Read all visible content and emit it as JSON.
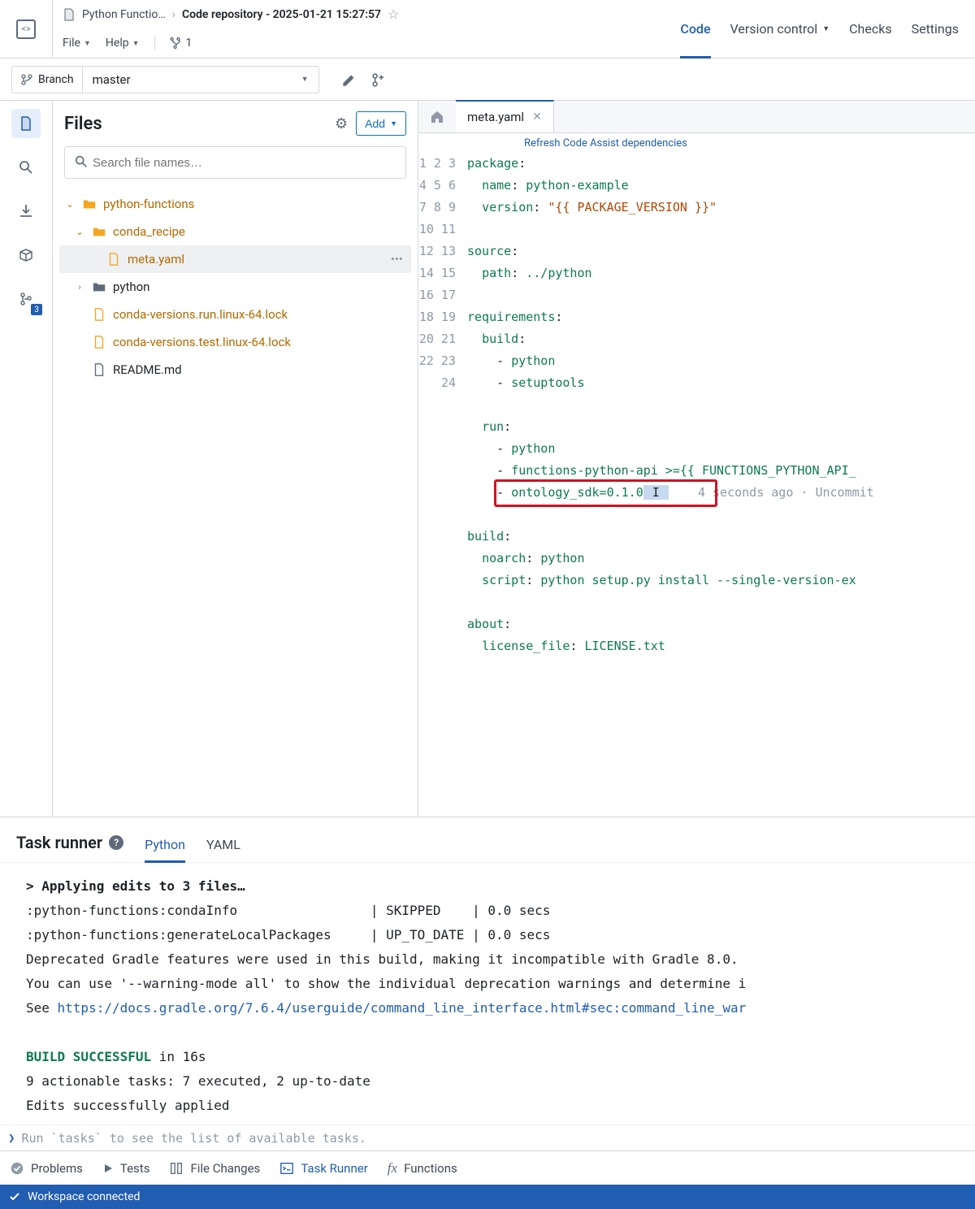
{
  "breadcrumb": {
    "project": "Python Functio…",
    "current": "Code repository - 2025-01-21 15:27:57"
  },
  "menu": {
    "file": "File",
    "help": "Help",
    "fork_count": "1"
  },
  "top_tabs": {
    "code": "Code",
    "version": "Version control",
    "checks": "Checks",
    "settings": "Settings"
  },
  "branch": {
    "label": "Branch",
    "value": "master"
  },
  "rail": {
    "badge": "3"
  },
  "files": {
    "title": "Files",
    "add": "Add",
    "search_placeholder": "Search file names…"
  },
  "tree": {
    "root": "python-functions",
    "conda": "conda_recipe",
    "meta": "meta.yaml",
    "python": "python",
    "lock1": "conda-versions.run.linux-64.lock",
    "lock2": "conda-versions.test.linux-64.lock",
    "readme": "README.md"
  },
  "editor": {
    "tab": "meta.yaml",
    "refresh": "Refresh Code Assist dependencies",
    "blame": "4 seconds ago · Uncommit"
  },
  "code": {
    "l1a": "package",
    "l1b": ":",
    "l2a": "name",
    "l2b": ": ",
    "l2c": "python-example",
    "l3a": "version",
    "l3b": ": ",
    "l3c": "\"{{ PACKAGE_VERSION }}\"",
    "l5a": "source",
    "l5b": ":",
    "l6a": "path",
    "l6b": ": ",
    "l6c": "../python",
    "l8a": "requirements",
    "l8b": ":",
    "l9a": "build",
    "l9b": ":",
    "l10a": "- ",
    "l10b": "python",
    "l11a": "- ",
    "l11b": "setuptools",
    "l13a": "run",
    "l13b": ":",
    "l14a": "- ",
    "l14b": "python",
    "l15a": "- ",
    "l15b": "functions-python-api >={{ FUNCTIONS_PYTHON_API_",
    "l16a": "- ",
    "l16b": "ontology_sdk=0.1.0",
    "l18a": "build",
    "l18b": ":",
    "l19a": "noarch",
    "l19b": ": ",
    "l19c": "python",
    "l20a": "script",
    "l20b": ": ",
    "l20c": "python setup.py install --single-version-ex",
    "l22a": "about",
    "l22b": ":",
    "l23a": "license_file",
    "l23b": ": ",
    "l23c": "LICENSE.txt"
  },
  "task": {
    "title": "Task runner",
    "tab_python": "Python",
    "tab_yaml": "YAML"
  },
  "console": {
    "l1": "> Applying edits to 3 files…",
    "l2": ":python-functions:condaInfo                 | SKIPPED    | 0.0 secs",
    "l3": ":python-functions:generateLocalPackages     | UP_TO_DATE | 0.0 secs",
    "l4": "Deprecated Gradle features were used in this build, making it incompatible with Gradle 8.0.",
    "l5": "You can use '--warning-mode all' to show the individual deprecation warnings and determine i",
    "l6a": "See ",
    "l6b": "https://docs.gradle.org/7.6.4/userguide/command_line_interface.html#sec:command_line_war",
    "l8a": "BUILD SUCCESSFUL",
    "l8b": " in 16s",
    "l9": "9 actionable tasks: 7 executed, 2 up-to-date",
    "l10": "Edits successfully applied",
    "prompt": "Run `tasks` to see the list of available tasks."
  },
  "status": {
    "problems": "Problems",
    "tests": "Tests",
    "file_changes": "File Changes",
    "task_runner": "Task Runner",
    "functions": "Functions"
  },
  "workspace": "Workspace connected"
}
